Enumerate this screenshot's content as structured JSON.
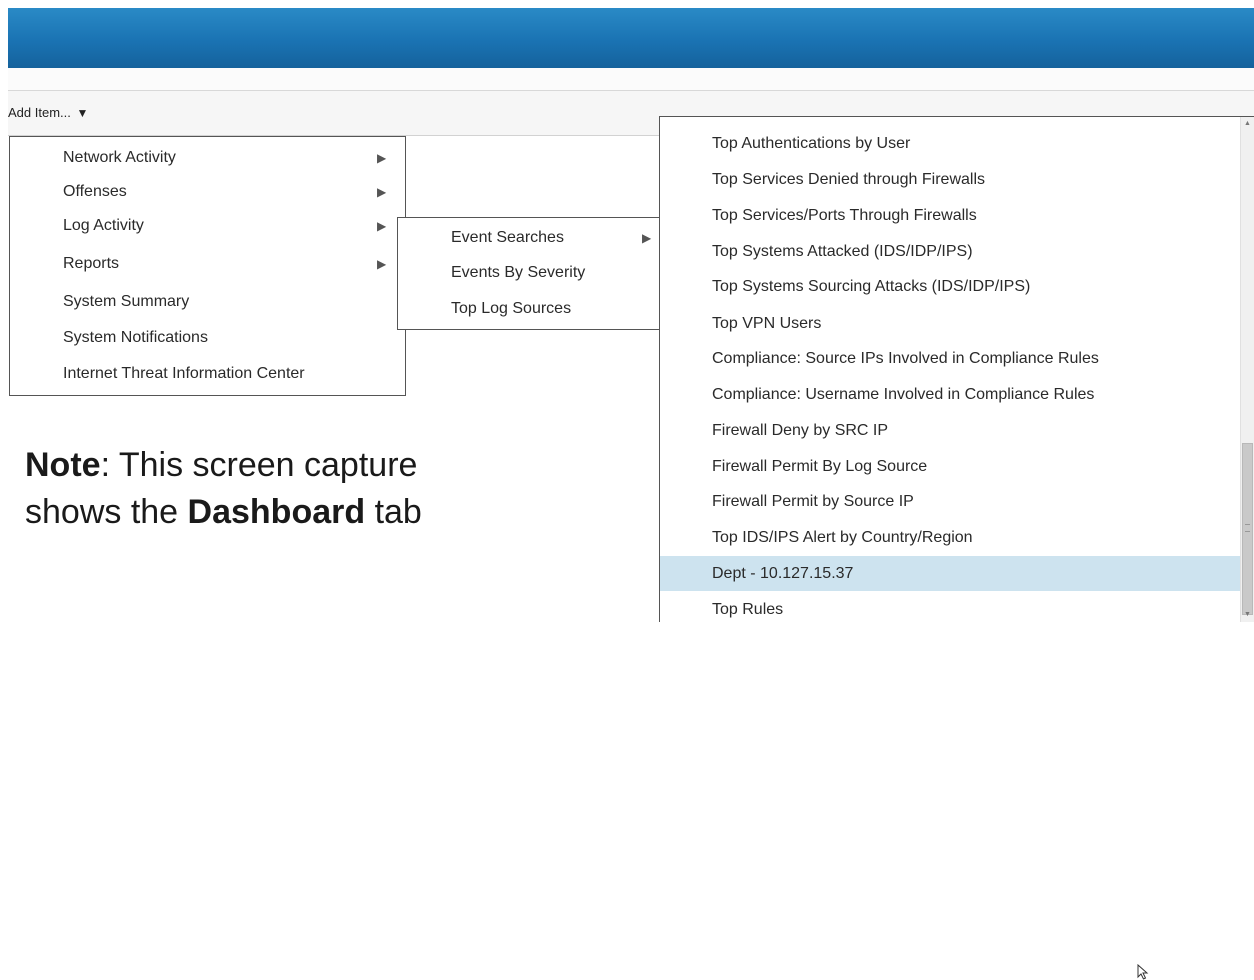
{
  "toolbar": {
    "add_item_label": "Add Item...",
    "add_item_caret": "▼"
  },
  "menu_level1": {
    "items": [
      {
        "label": "Network Activity",
        "has_submenu": true
      },
      {
        "label": "Offenses",
        "has_submenu": true
      },
      {
        "label": "Log Activity",
        "has_submenu": true
      },
      {
        "label": "Reports",
        "has_submenu": true
      },
      {
        "label": "System Summary",
        "has_submenu": false
      },
      {
        "label": "System Notifications",
        "has_submenu": false
      },
      {
        "label": "Internet Threat Information Center",
        "has_submenu": false
      }
    ]
  },
  "menu_level2": {
    "items": [
      {
        "label": "Event Searches",
        "has_submenu": true
      },
      {
        "label": "Events By Severity",
        "has_submenu": false
      },
      {
        "label": "Top Log Sources",
        "has_submenu": false
      }
    ]
  },
  "menu_level3": {
    "items": [
      {
        "label": "Top Authentications by User"
      },
      {
        "label": "Top Services Denied through Firewalls"
      },
      {
        "label": "Top Services/Ports Through Firewalls"
      },
      {
        "label": "Top Systems Attacked (IDS/IDP/IPS)"
      },
      {
        "label": "Top Systems Sourcing Attacks (IDS/IDP/IPS)"
      },
      {
        "label": "Top VPN Users"
      },
      {
        "label": "Compliance: Source IPs Involved in Compliance Rules"
      },
      {
        "label": "Compliance: Username Involved in Compliance Rules"
      },
      {
        "label": "Firewall Deny by SRC IP"
      },
      {
        "label": "Firewall Permit By Log Source"
      },
      {
        "label": "Firewall Permit by Source IP"
      },
      {
        "label": "Top IDS/IPS Alert by Country/Region"
      },
      {
        "label": "Dept - 10.127.15.37",
        "highlighted": true
      },
      {
        "label": "Top Rules"
      }
    ]
  },
  "note": {
    "prefix_bold": "Note",
    "text_1": ": This screen capture",
    "text_2": "shows the ",
    "bold_2": "Dashboard",
    "text_3": " tab"
  },
  "icons": {
    "submenu_arrow": "▶",
    "scroll_up": "▲",
    "scroll_down": "▼"
  },
  "colors": {
    "header_blue": "#1a73b3",
    "highlight": "#cde3ef"
  }
}
